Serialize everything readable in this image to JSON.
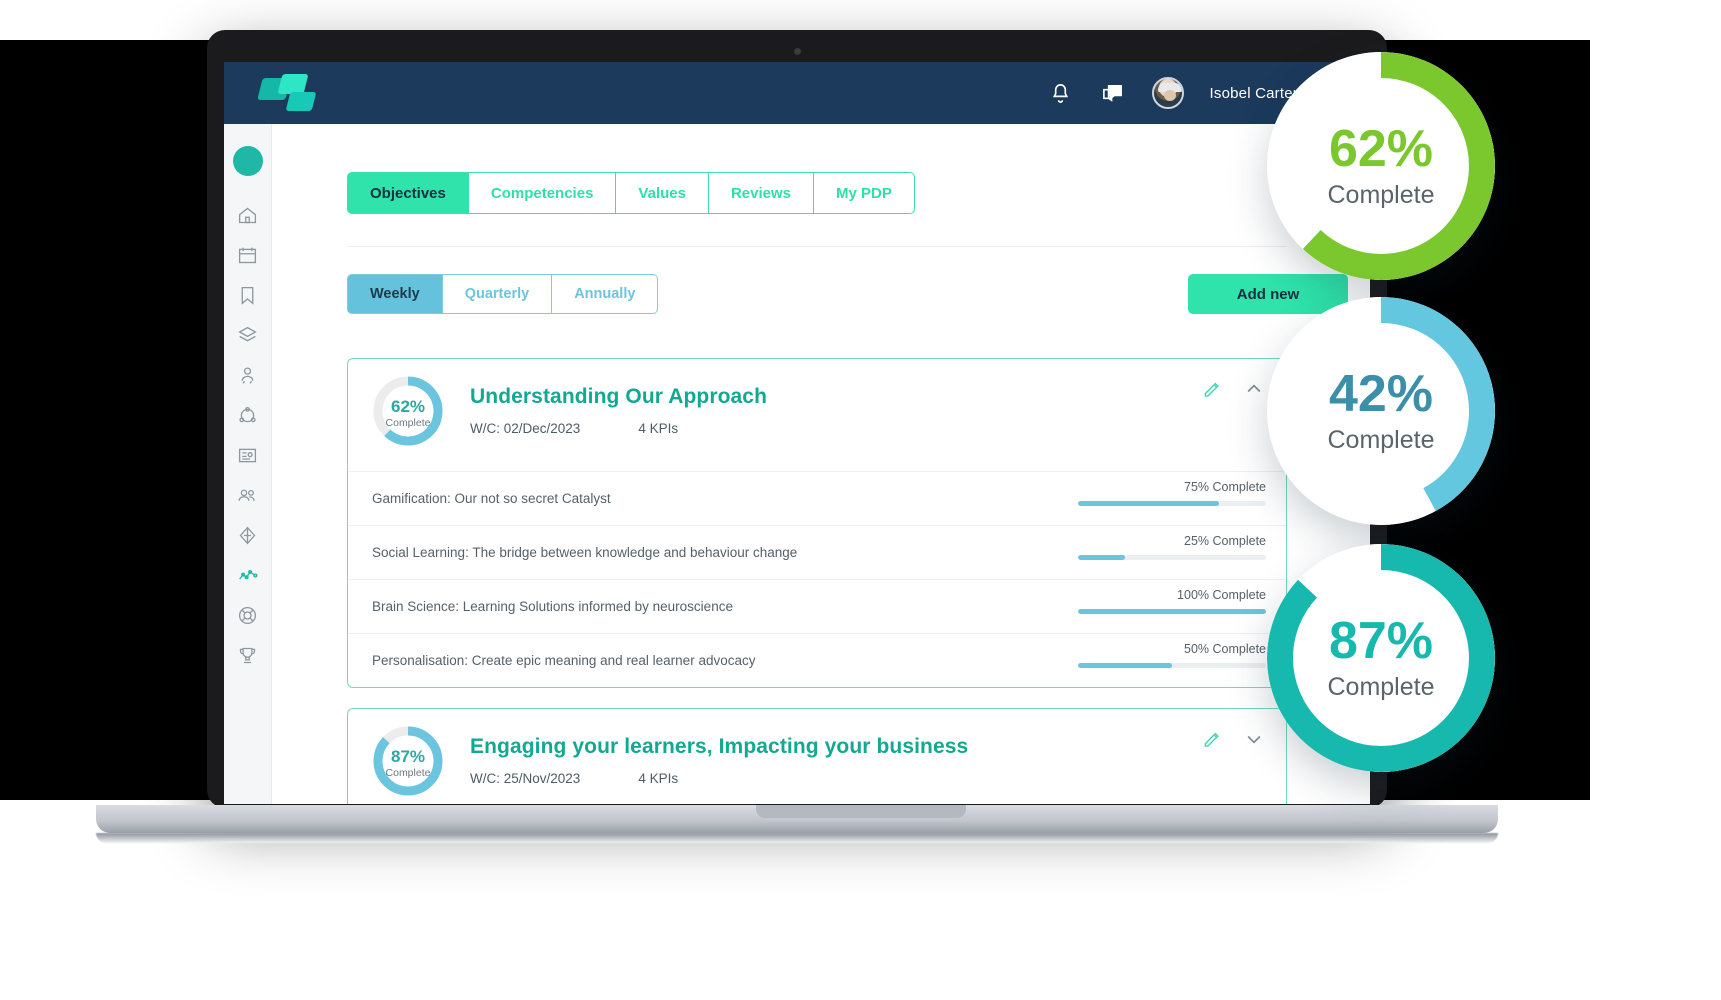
{
  "app": {
    "brand_name": "logo-mark",
    "header": {
      "notifications_icon": "bell-icon",
      "messages_icon": "chat-icon",
      "user_name": "Isobel Carter",
      "caret_icon": "chevron-down-icon"
    }
  },
  "sidebar": {
    "items": [
      {
        "icon": "home-icon",
        "active": false
      },
      {
        "icon": "calendar-icon",
        "active": false
      },
      {
        "icon": "bookmark-icon",
        "active": false
      },
      {
        "icon": "layers-icon",
        "active": false
      },
      {
        "icon": "user-rating-icon",
        "active": false
      },
      {
        "icon": "network-icon",
        "active": false
      },
      {
        "icon": "id-card-icon",
        "active": false
      },
      {
        "icon": "people-icon",
        "active": false
      },
      {
        "icon": "diamond-icon",
        "active": false
      },
      {
        "icon": "graph-icon",
        "active": true
      },
      {
        "icon": "lifebuoy-icon",
        "active": false
      },
      {
        "icon": "trophy-icon",
        "active": false
      }
    ]
  },
  "tabs": [
    {
      "label": "Objectives",
      "active": true
    },
    {
      "label": "Competencies",
      "active": false
    },
    {
      "label": "Values",
      "active": false
    },
    {
      "label": "Reviews",
      "active": false
    },
    {
      "label": "My PDP",
      "active": false
    }
  ],
  "filters": [
    {
      "label": "Weekly",
      "active": true
    },
    {
      "label": "Quarterly",
      "active": false
    },
    {
      "label": "Annually",
      "active": false
    }
  ],
  "actions": {
    "add_new_label": "Add new"
  },
  "colors": {
    "header_navy": "#1b3a5c",
    "accent_green": "#2fe3ab",
    "accent_teal": "#13a892",
    "accent_blue": "#64c2dd",
    "bar_blue": "#6bc5de",
    "lime": "#7ac72e"
  },
  "objectives": [
    {
      "progress": 62,
      "progress_num": "62%",
      "progress_label": "Complete",
      "title": "Understanding Our Approach",
      "week_commencing": "W/C: 02/Dec/2023",
      "kpi_count": "4  KPIs",
      "edit_icon": "pencil-icon",
      "toggle_icon": "chevron-up-icon",
      "expanded": true,
      "kpis": [
        {
          "name": "Gamification: Our not so secret Catalyst",
          "percent": 75,
          "percent_label": "75% Complete"
        },
        {
          "name": "Social Learning: The bridge between knowledge and behaviour change",
          "percent": 25,
          "percent_label": "25% Complete"
        },
        {
          "name": "Brain Science: Learning Solutions informed by neuroscience",
          "percent": 100,
          "percent_label": "100% Complete"
        },
        {
          "name": "Personalisation: Create epic meaning and real learner advocacy",
          "percent": 50,
          "percent_label": "50% Complete"
        }
      ]
    },
    {
      "progress": 87,
      "progress_num": "87%",
      "progress_label": "Complete",
      "title": "Engaging your learners, Impacting your business",
      "week_commencing": "W/C: 25/Nov/2023",
      "kpi_count": "4  KPIs",
      "edit_icon": "pencil-icon",
      "toggle_icon": "chevron-down-icon",
      "expanded": false,
      "kpis": []
    }
  ],
  "callouts": [
    {
      "num": "62%",
      "label": "Complete",
      "percent": 62,
      "ring_color": "#7ac72e",
      "num_color": "#7ac72e"
    },
    {
      "num": "42%",
      "label": "Complete",
      "percent": 42,
      "ring_color": "#63c7e0",
      "num_color": "#3c8fa8"
    },
    {
      "num": "87%",
      "label": "Complete",
      "percent": 87,
      "ring_color": "#17b8ae",
      "num_color": "#17b8ae"
    }
  ]
}
